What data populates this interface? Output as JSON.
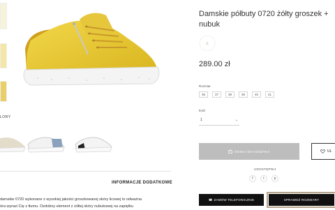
{
  "product": {
    "title_line1": "Damskie półbuty 0720 żółty groszek +",
    "title_line2": "nubuk",
    "price": "289.00 zł",
    "seal_text": "E"
  },
  "sizes": {
    "label": "Rozmiar",
    "options": [
      "36",
      "37",
      "38",
      "39",
      "40",
      "41"
    ]
  },
  "quantity": {
    "label": "Ilość",
    "value": "1",
    "chevron": "⌄"
  },
  "actions": {
    "cart": "DODAJ DO KOSZYKA",
    "wishlist": "UL",
    "phone_order": "ZAMÓW TELEFONICZNIE",
    "size_check": "SPRAWDŹ ROZMIARY"
  },
  "share": {
    "label": "UDOSTĘPNIJ",
    "icons": [
      "f",
      "t",
      "p"
    ]
  },
  "gallery": {
    "colors_label": "LORY"
  },
  "info": {
    "extra_label": "INFORMACJE DODATKOWE",
    "desc_line1": "damskie 0720 wykonane z wysokiej jakości groszkowanej skóry licowej to odważna",
    "desc_line2": "óra wyrazi Cię z tłumu. Ozdobny element z żółtej skóry nubukowej na zapiętku"
  },
  "colors": {
    "shoe_yellow": "#e8c72e",
    "sole_white": "#f4f4f4",
    "cart_grey": "#bdbdbd",
    "button_black": "#111111",
    "focus_outline": "#b5a68a"
  }
}
